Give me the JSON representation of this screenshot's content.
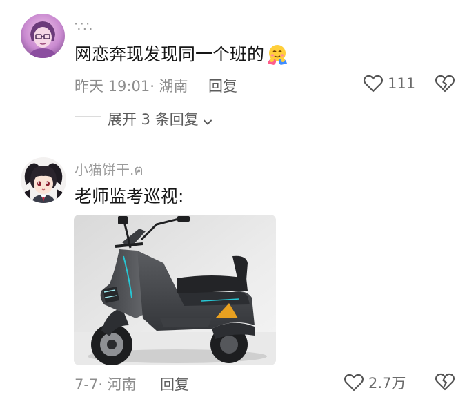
{
  "comments": [
    {
      "username": "∵∴",
      "text": "网恋奔现发现同一个班的",
      "emoji": "hug-face-emoji",
      "time": "昨天 19:01",
      "location": "· 湖南",
      "reply_label": "回复",
      "likes": "111",
      "expand_label": "展开 3 条回复"
    },
    {
      "username": "小猫饼干.ฅ",
      "text": "老师监考巡视:",
      "time": "7-7",
      "location": "· 河南",
      "reply_label": "回复",
      "likes": "2.7万",
      "image": "electric-scooter-photo"
    }
  ],
  "colors": {
    "text": "#161616",
    "meta": "#8d8d8d",
    "username": "#9a9a9a"
  }
}
